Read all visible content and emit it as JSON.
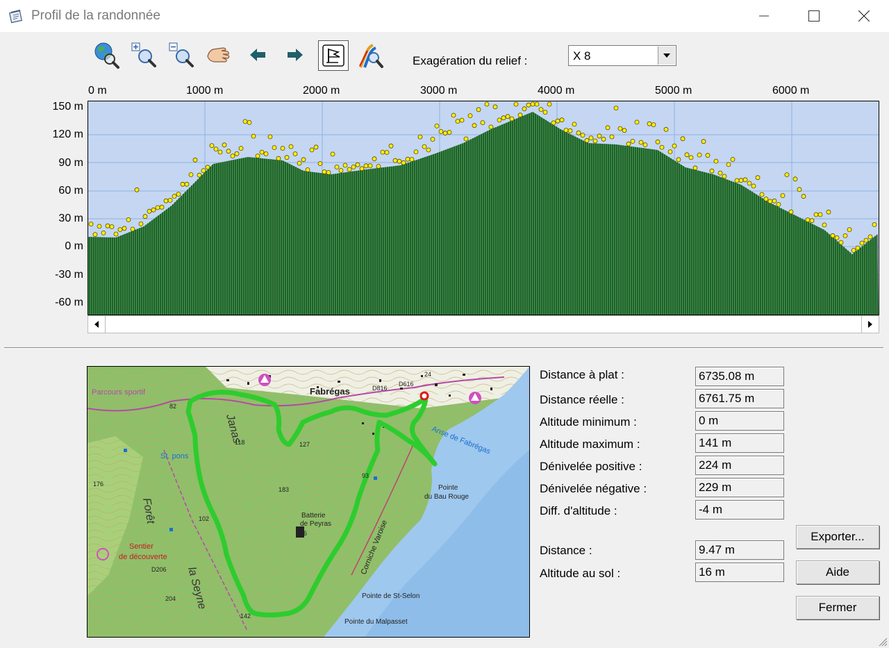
{
  "window": {
    "title": "Profil de la randonnée"
  },
  "toolbar": {
    "tools": [
      "globe-zoom-icon",
      "zoom-in-icon",
      "zoom-out-icon",
      "hand-pan-icon",
      "arrow-left-icon",
      "arrow-right-icon",
      "flag-icon",
      "route-zoom-icon"
    ],
    "active_tool": "flag-icon",
    "relief_label": "Exagération du relief :",
    "relief_value": "X 8"
  },
  "profile": {
    "x_ticks": [
      "0 m",
      "1000 m",
      "2000 m",
      "3000 m",
      "4000 m",
      "5000 m",
      "6000 m"
    ],
    "y_ticks": [
      "150 m",
      "120 m",
      "90 m",
      "60 m",
      "30 m",
      "0 m",
      "-30 m",
      "-60 m"
    ],
    "colors": {
      "sky": "#c4d6f2",
      "terrain": "#3c9c4c",
      "points": "#ffee00",
      "grid": "#8fb1df"
    }
  },
  "map": {
    "labels": {
      "fabregas": "Fabrégas",
      "anse": "Anse de Fabrégas",
      "pointe_bau": "Pointe",
      "pointe_bau2": "du Bau Rouge",
      "batterie": "Batterie",
      "peyras": "de Peyras",
      "selon": "Pointe de St-Selon",
      "malpasset": "Pointe du Malpasset",
      "janas": "Janas",
      "foret": "Forêt",
      "seyne": "la Seyne",
      "sentier": "Sentier",
      "decouverte": "de découverte",
      "corniche": "Corniche Varoise",
      "ecole": "Parcours sportif",
      "stpons": "St. pons",
      "alt183": "183",
      "alt127": "127",
      "alt118": "118",
      "alt176": "176",
      "alt204": "204",
      "alt142": "142",
      "alt96": "96",
      "alt82": "82",
      "alt102": "102",
      "alt93": "93",
      "d816": "D816",
      "d616": "D616",
      "d206": "D206",
      "n24": "24"
    }
  },
  "stats": [
    {
      "label": "Distance à plat :",
      "value": "6735.08 m"
    },
    {
      "label": "Distance réelle :",
      "value": "6761.75 m"
    },
    {
      "label": "Altitude minimum :",
      "value": "0 m"
    },
    {
      "label": "Altitude maximum :",
      "value": "141 m"
    },
    {
      "label": "Dénivelée positive :",
      "value": "224 m"
    },
    {
      "label": "Dénivelée négative :",
      "value": "229 m"
    },
    {
      "label": "Diff. d'altitude :",
      "value": "-4 m"
    }
  ],
  "cursor": [
    {
      "label": "Distance :",
      "value": "9.47 m"
    },
    {
      "label": "Altitude au sol :",
      "value": "16 m"
    }
  ],
  "buttons": {
    "export": "Exporter...",
    "help": "Aide",
    "close": "Fermer"
  }
}
